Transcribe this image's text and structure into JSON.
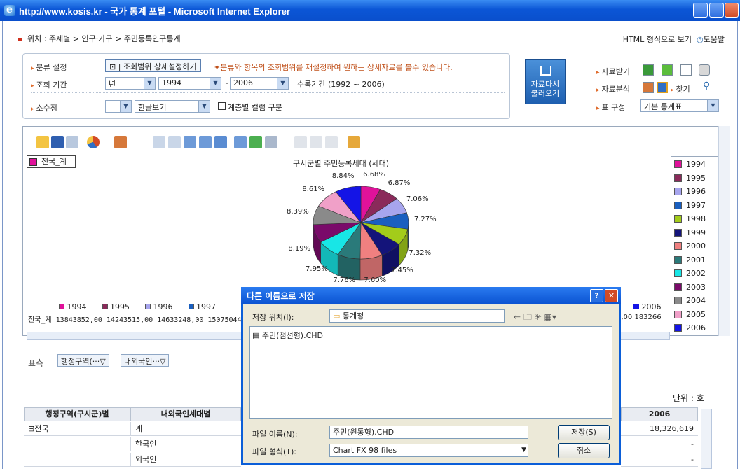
{
  "window": {
    "title": "http://www.kosis.kr - 국가 통계 포털 - Microsoft Internet Explorer"
  },
  "location": {
    "label": "위치 :",
    "path": "주제별 > 인구·가구 > 주민등록인구통계"
  },
  "toplinks": {
    "html": "HTML 형식으로 보기",
    "help": "도움말"
  },
  "filters": {
    "classify_label": "분류 설정",
    "classify_btn": "조회범위 상세설정하기",
    "classify_note": "분류와 항목의 조회범위를 재설정하여 원하는 상세자료를 볼수 있습니다.",
    "period_label": "조회 기간",
    "period_unit": "년",
    "period_from": "1994",
    "period_sep": "~",
    "period_to": "2006",
    "period_note": "수록기간 (1992 ~ 2006)",
    "decimal_label": "소수점",
    "decimal_value": "",
    "lang_value": "한글보기",
    "hier_label": "계층별 컬럼 구분"
  },
  "reload": {
    "label1": "자료다시",
    "label2": "불러오기"
  },
  "right": {
    "download": "자료받기",
    "analysis": "자료분석",
    "find": "찾기",
    "table_label": "표 구성",
    "table_value": "기본 통계표"
  },
  "chart": {
    "combo": "전국_계",
    "title": "구시군별 주민등록세대 (세대)"
  },
  "chart_data": {
    "type": "pie",
    "title": "구시군별 주민등록세대 (세대)",
    "categories": [
      "1994",
      "1995",
      "1996",
      "1997",
      "1998",
      "1999",
      "2000",
      "2001",
      "2002",
      "2003",
      "2004",
      "2005",
      "2006"
    ],
    "values": [
      6.68,
      6.87,
      7.06,
      7.27,
      7.32,
      7.45,
      7.6,
      7.76,
      7.95,
      8.19,
      8.39,
      8.61,
      8.84
    ],
    "colors": [
      "#e0129a",
      "#8a2a5a",
      "#a7a5ee",
      "#1a5fbf",
      "#a3cc1a",
      "#14147a",
      "#f08080",
      "#2a7a7a",
      "#18e6e6",
      "#7a0a6a",
      "#8a8a8a",
      "#f0a0c8",
      "#1414e6"
    ],
    "labels": [
      "6.68%",
      "6.87%",
      "7.06%",
      "7.27%",
      "7.32%",
      "7.45%",
      "7.60%",
      "7.76%",
      "7.95%",
      "8.19%",
      "8.39%",
      "8.61%",
      "8.84%"
    ]
  },
  "datastrip": {
    "row_label": "전국_계",
    "values": "13843852,00 14243515,00 14633248,00 15075044,(",
    "tail": "1,00 183266",
    "year_tail": "2006"
  },
  "pivot": {
    "label": "표측",
    "btn1": "행정구역(···▽",
    "btn2": "내외국인···▽"
  },
  "unit": "단위 : 호",
  "table": {
    "h1": "행정구역(구시군)별",
    "h2": "내외국인세대별",
    "h3": "2006",
    "rows": [
      {
        "c1": "⊟전국",
        "c2": "계",
        "v": "18,326,619"
      },
      {
        "c1": "",
        "c2": "한국인",
        "v": "-"
      },
      {
        "c1": "",
        "c2": "외국인",
        "v": "-"
      }
    ]
  },
  "dialog": {
    "title": "다른 이름으로 저장",
    "loc_label": "저장 위치(I):",
    "loc_value": "통계청",
    "file": "주민(점선형).CHD",
    "name_label": "파일 이름(N):",
    "name_value": "주민(원통형).CHD",
    "type_label": "파일 형식(T):",
    "type_value": "Chart FX 98 files",
    "save": "저장(S)",
    "cancel": "취소"
  }
}
